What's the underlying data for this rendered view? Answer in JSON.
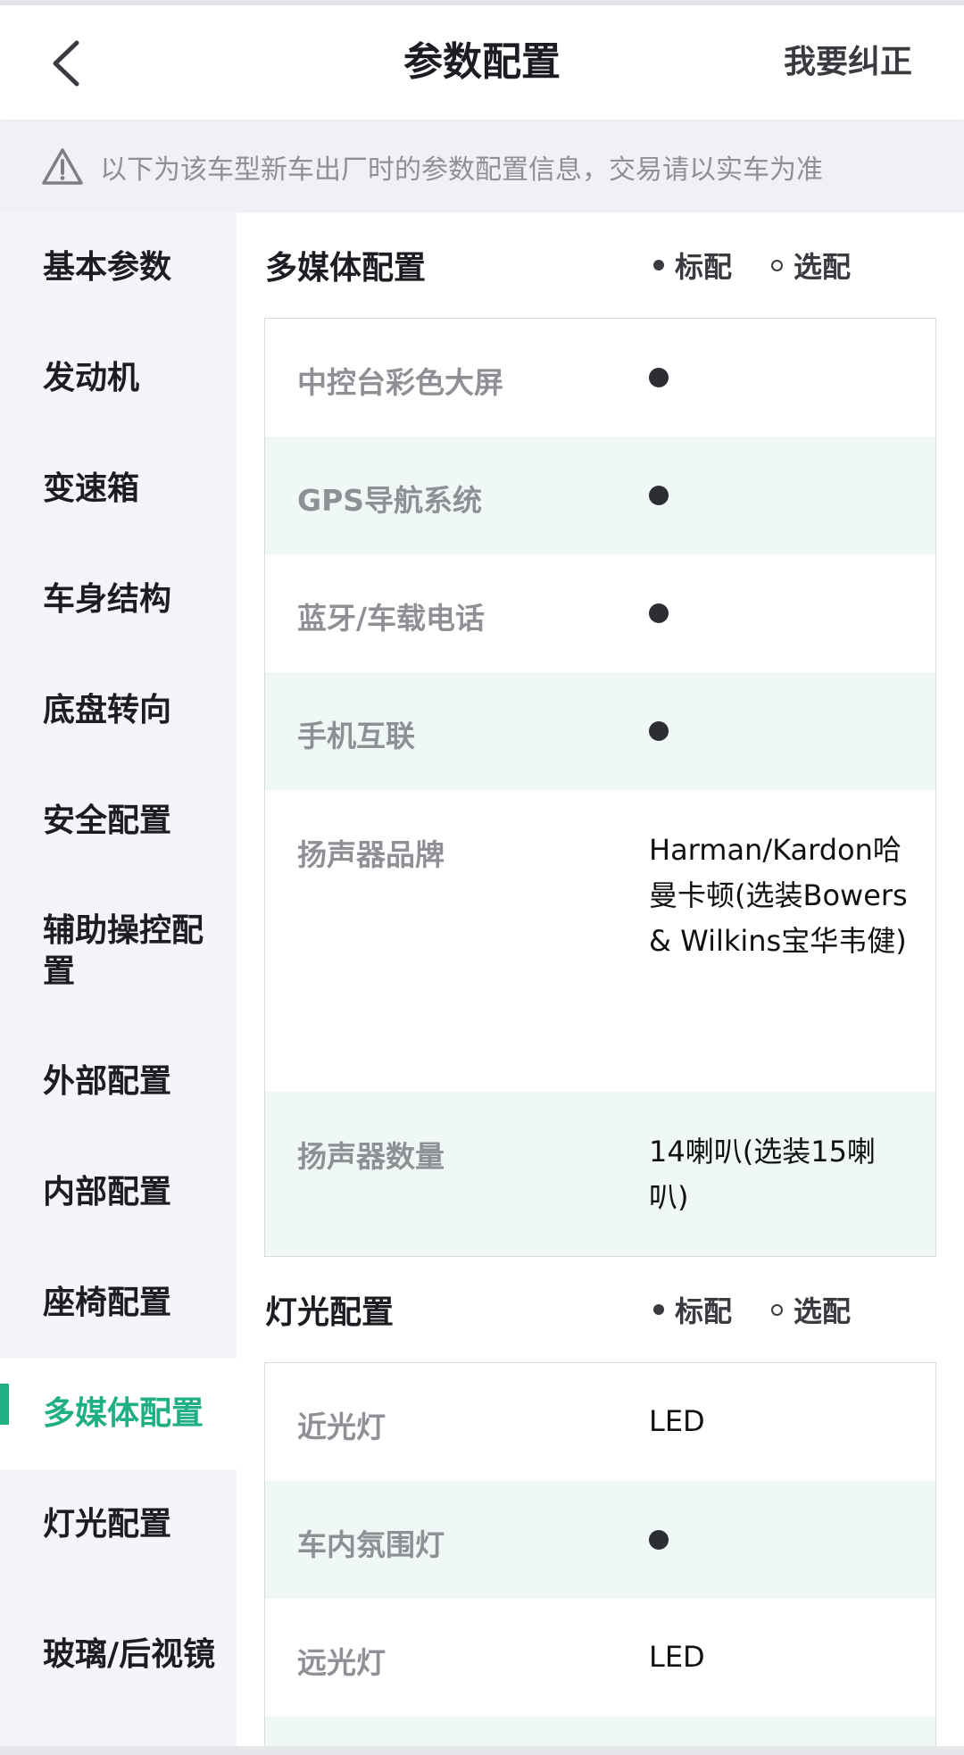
{
  "header": {
    "title": "参数配置",
    "correct_label": "我要纠正"
  },
  "notice": {
    "text": "以下为该车型新车出厂时的参数配置信息，交易请以实车为准"
  },
  "sidebar": {
    "items": [
      {
        "label": "基本参数"
      },
      {
        "label": "发动机"
      },
      {
        "label": "变速箱"
      },
      {
        "label": "车身结构"
      },
      {
        "label": "底盘转向"
      },
      {
        "label": "安全配置"
      },
      {
        "label": "辅助操控配置"
      },
      {
        "label": "外部配置"
      },
      {
        "label": "内部配置"
      },
      {
        "label": "座椅配置"
      },
      {
        "label": "多媒体配置",
        "active": true
      },
      {
        "label": "灯光配置"
      },
      {
        "label": "玻璃/后视镜"
      }
    ]
  },
  "legend": {
    "standard": "标配",
    "optional": "选配"
  },
  "sections": [
    {
      "title": "多媒体配置",
      "rows": [
        {
          "label": "中控台彩色大屏",
          "value": "●",
          "type": "standard"
        },
        {
          "label": "GPS导航系统",
          "value": "●",
          "type": "standard"
        },
        {
          "label": "蓝牙/车载电话",
          "value": "●",
          "type": "standard"
        },
        {
          "label": "手机互联",
          "value": "●",
          "type": "standard"
        },
        {
          "label": "扬声器品牌",
          "value": "Harman/Kardon哈曼卡顿(选装Bowers & Wilkins宝华韦健)",
          "type": "text"
        },
        {
          "label": "扬声器数量",
          "value": "14喇叭(选装15喇叭)",
          "type": "text"
        }
      ]
    },
    {
      "title": "灯光配置",
      "rows": [
        {
          "label": "近光灯",
          "value": "LED",
          "type": "text"
        },
        {
          "label": "车内氛围灯",
          "value": "●",
          "type": "standard"
        },
        {
          "label": "远光灯",
          "value": "LED",
          "type": "text"
        }
      ]
    }
  ],
  "colors": {
    "accent": "#1faf83",
    "row_tint": "#f0f8f5"
  }
}
